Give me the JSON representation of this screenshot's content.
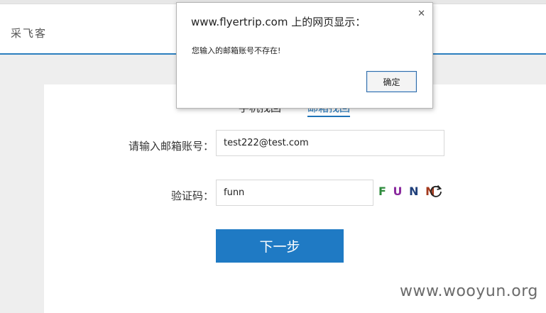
{
  "site": {
    "logo": "采飞客"
  },
  "tabs": {
    "phone": "手机找回",
    "email": "邮箱找回"
  },
  "form": {
    "email_label": "请输入邮箱账号：",
    "email_value": "test222@test.com",
    "code_label": "验证码：",
    "code_value": "funn",
    "captcha_chars": [
      "F",
      "U",
      "N",
      "N"
    ],
    "captcha_colors": [
      "#2e8b3c",
      "#8a2a9e",
      "#1f3f7a",
      "#a33a1e"
    ],
    "refresh_icon": "refresh-icon",
    "next_label": "下一步"
  },
  "dialog": {
    "title": "www.flyertrip.com 上的网页显示：",
    "message": "您输入的邮箱账号不存在!",
    "ok_label": "确定",
    "close_symbol": "✕"
  },
  "watermark": "www.wooyun.org",
  "colors": {
    "accent": "#1f7ac4",
    "header_border": "#2c7fbf"
  }
}
